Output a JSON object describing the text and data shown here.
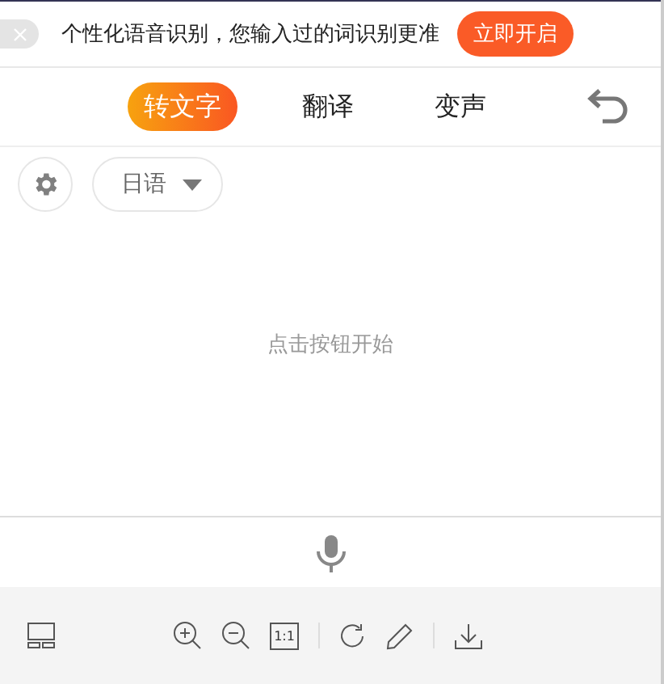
{
  "banner": {
    "message": "个性化语音识别，您输入过的词识别更准",
    "action": "立即开启"
  },
  "tabs": [
    {
      "label": "转文字",
      "selected": true
    },
    {
      "label": "翻译",
      "selected": false
    },
    {
      "label": "变声",
      "selected": false
    }
  ],
  "language": {
    "value": "日语"
  },
  "hint": "点击按钮开始",
  "toolbar": {
    "actual_size": "1:1"
  }
}
